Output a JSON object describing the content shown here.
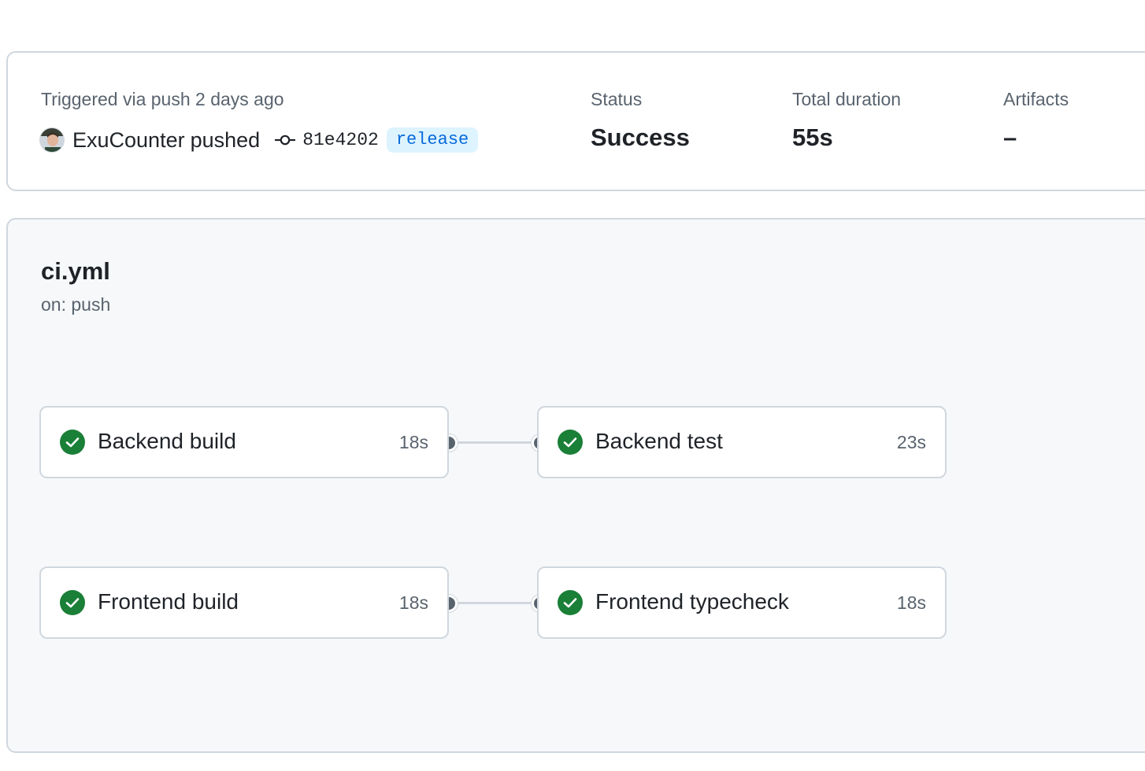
{
  "summary": {
    "trigger_text": "Triggered via push 2 days ago",
    "actor_name": "ExuCounter",
    "actor_verb": "pushed",
    "commit_sha": "81e4202",
    "branch": "release",
    "status_label": "Status",
    "status_value": "Success",
    "duration_label": "Total duration",
    "duration_value": "55s",
    "artifacts_label": "Artifacts",
    "artifacts_value": "–"
  },
  "workflow": {
    "name": "ci.yml",
    "trigger": "on: push",
    "jobs": [
      {
        "name": "Backend build",
        "duration": "18s",
        "status": "success"
      },
      {
        "name": "Backend test",
        "duration": "23s",
        "status": "success"
      },
      {
        "name": "Frontend build",
        "duration": "18s",
        "status": "success"
      },
      {
        "name": "Frontend typecheck",
        "duration": "18s",
        "status": "success"
      }
    ]
  },
  "colors": {
    "success": "#1a7f37",
    "link": "#0969da",
    "muted": "#59636e",
    "border": "#d0d7de"
  },
  "icons": {
    "commit": "git-commit-icon",
    "status": "check-circle-fill-icon"
  }
}
